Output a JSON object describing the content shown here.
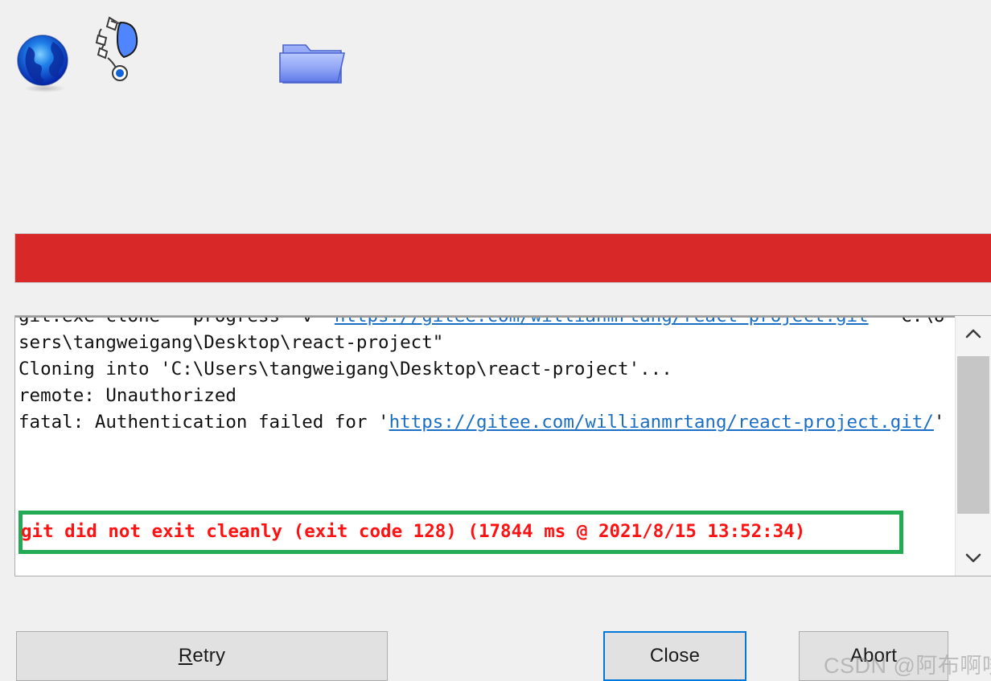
{
  "toolbar": {
    "icons": [
      {
        "name": "globe-icon",
        "label": "Globe"
      },
      {
        "name": "network-branch-icon",
        "label": "Network"
      },
      {
        "name": "folder-icon",
        "label": "Folder"
      }
    ]
  },
  "progress": {
    "state": "error",
    "percent": 100,
    "color": "#d92828"
  },
  "log": {
    "lines": [
      {
        "segments": [
          {
            "text": "git.exe clone --progress -v \"",
            "link": false
          },
          {
            "text": "https://gitee.com/willianmrtang/react-project.git",
            "link": true
          },
          {
            "text": "\" \"C:\\Users\\tangweigang\\Desktop\\react-project\"",
            "link": false
          }
        ]
      },
      {
        "segments": [
          {
            "text": "Cloning into 'C:\\Users\\tangweigang\\Desktop\\react-project'...",
            "link": false
          }
        ]
      },
      {
        "segments": [
          {
            "text": "remote: Unauthorized",
            "link": false
          }
        ]
      },
      {
        "segments": [
          {
            "text": "fatal: Authentication failed for '",
            "link": false
          },
          {
            "text": "https://gitee.com/willianmrtang/react-project.git/",
            "link": true
          },
          {
            "text": "'",
            "link": false
          }
        ]
      }
    ],
    "error_message": "git did not exit cleanly (exit code 128) (17844 ms @ 2021/8/15 13:52:34)",
    "error_border_color": "#22aa55",
    "error_text_color": "#ff1111",
    "link_color": "#1a6fc4"
  },
  "scrollbar": {
    "up_arrow": "chevron-up-icon",
    "down_arrow": "chevron-down-icon"
  },
  "buttons": {
    "retry": {
      "accel": "R",
      "rest": "etry"
    },
    "close": {
      "label": "Close",
      "focused": true,
      "focus_color": "#0078d7"
    },
    "abort": {
      "label": "Abort"
    }
  },
  "watermark": {
    "text": "CSDN @阿布啊哆哆"
  }
}
